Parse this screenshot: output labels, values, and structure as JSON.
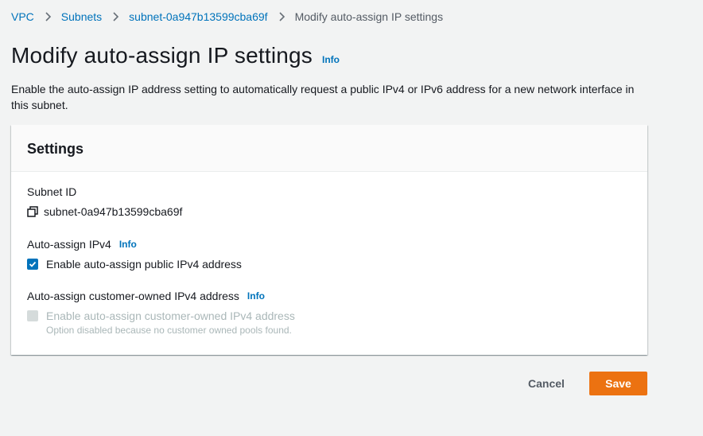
{
  "breadcrumb": {
    "items": [
      {
        "label": "VPC"
      },
      {
        "label": "Subnets"
      },
      {
        "label": "subnet-0a947b13599cba69f"
      },
      {
        "label": "Modify auto-assign IP settings"
      }
    ]
  },
  "header": {
    "title": "Modify auto-assign IP settings",
    "info_label": "Info"
  },
  "description": "Enable the auto-assign IP address setting to automatically request a public IPv4 or IPv6 address for a new network interface in this subnet.",
  "settings": {
    "title": "Settings",
    "subnet_id": {
      "label": "Subnet ID",
      "value": "subnet-0a947b13599cba69f",
      "icon": "copy-icon"
    },
    "auto_assign_ipv4": {
      "label": "Auto-assign IPv4",
      "info_label": "Info",
      "checkbox_label": "Enable auto-assign public IPv4 address",
      "checked": true
    },
    "auto_assign_customer_owned": {
      "label": "Auto-assign customer-owned IPv4 address",
      "info_label": "Info",
      "checkbox_label": "Enable auto-assign customer-owned IPv4 address",
      "checked": false,
      "disabled": true,
      "hint": "Option disabled because no customer owned pools found."
    }
  },
  "actions": {
    "cancel_label": "Cancel",
    "save_label": "Save"
  },
  "colors": {
    "link": "#0073bb",
    "primary_button": "#ec7211",
    "checkbox_checked": "#0073bb",
    "background": "#f2f3f3"
  }
}
